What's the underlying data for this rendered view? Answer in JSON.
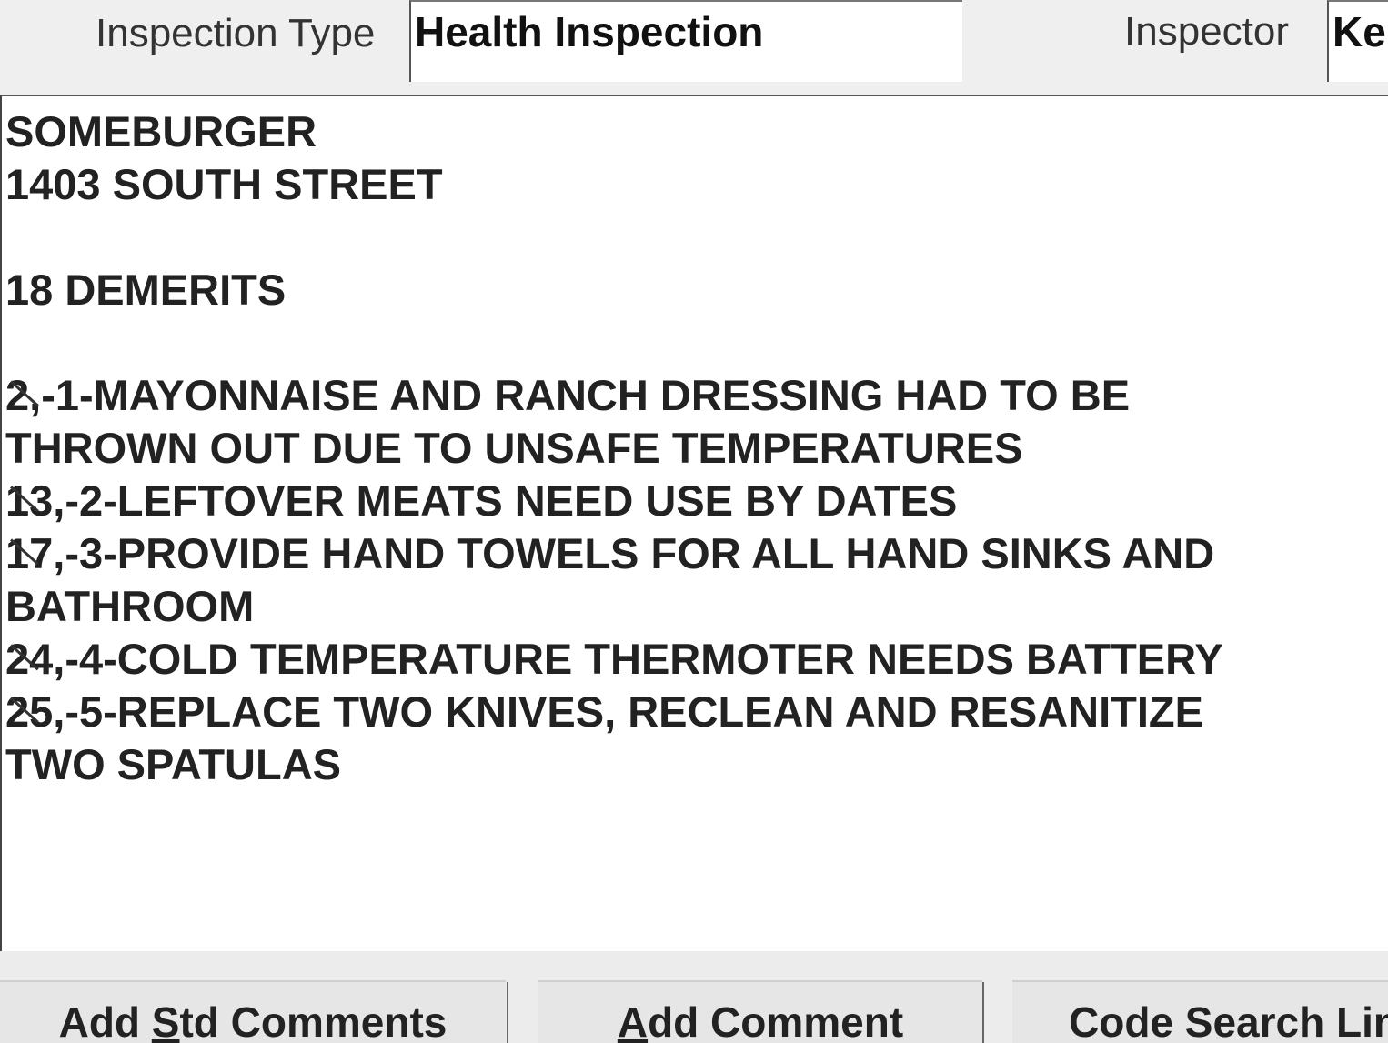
{
  "header": {
    "inspection_type_label": "Inspection Type",
    "inspection_type_value": "Health Inspection",
    "inspector_label": "Inspector",
    "inspector_value": "Ke"
  },
  "comments": {
    "lines": [
      {
        "prefix": "",
        "text": "SOMEBURGER"
      },
      {
        "prefix": "",
        "text": "1403 SOUTH STREET"
      },
      {
        "prefix": "",
        "text": ""
      },
      {
        "prefix": "",
        "text": "18 DEMERITS"
      },
      {
        "prefix": "",
        "text": ""
      },
      {
        "prefix": "2",
        "text": ",-1-MAYONNAISE AND RANCH DRESSING HAD TO BE"
      },
      {
        "prefix": "",
        "text": "THROWN OUT DUE TO UNSAFE TEMPERATURES"
      },
      {
        "prefix": "13",
        "text": ",-2-LEFTOVER MEATS NEED USE BY DATES"
      },
      {
        "prefix": "17",
        "text": ",-3-PROVIDE HAND TOWELS FOR ALL HAND SINKS AND"
      },
      {
        "prefix": "",
        "text": "BATHROOM"
      },
      {
        "prefix": "24",
        "text": ",-4-COLD TEMPERATURE THERMOTER NEEDS BATTERY"
      },
      {
        "prefix": "25",
        "text": ",-5-REPLACE TWO KNIVES, RECLEAN AND RESANITIZE"
      },
      {
        "prefix": "",
        "text": "TWO SPATULAS"
      }
    ]
  },
  "buttons": {
    "add_std_comments": {
      "before": "Add ",
      "accel": "S",
      "after": "td Comments"
    },
    "add_comment": {
      "before": "",
      "accel": "A",
      "after": "dd Comment"
    },
    "code_search": {
      "before": "Code Search Li",
      "accel": "",
      "after": "n"
    }
  }
}
